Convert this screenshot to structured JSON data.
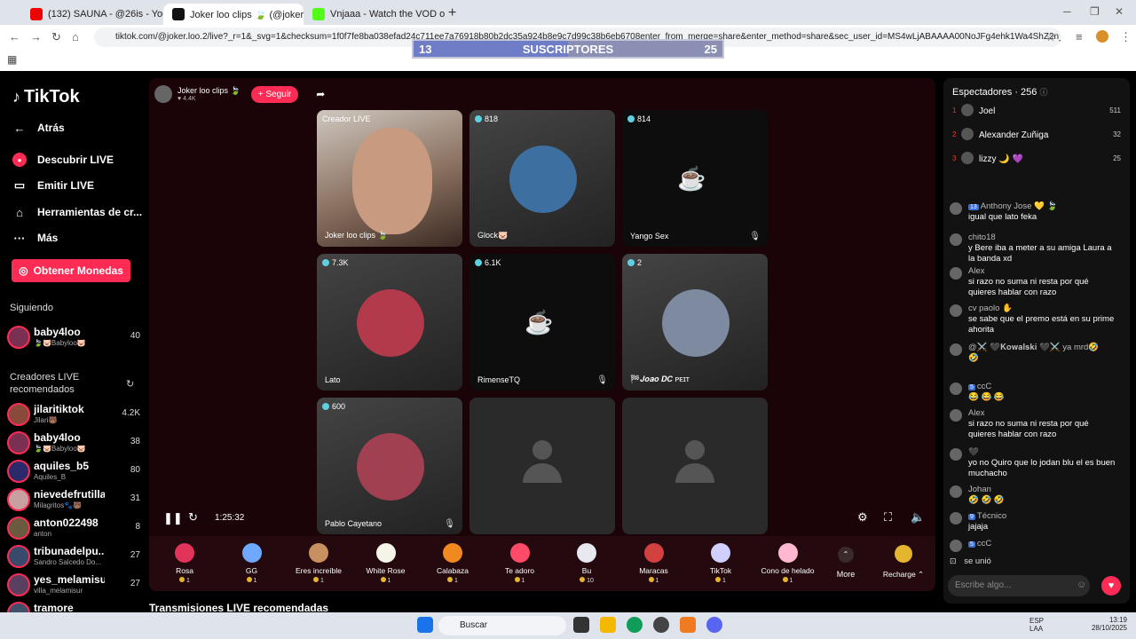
{
  "browser": {
    "tabs": [
      {
        "title": "(132) SAUNA - @26is - YouTube",
        "fav": "#e00"
      },
      {
        "title": "Joker loo clips 🍃 (@joker.l",
        "fav": "#111"
      },
      {
        "title": "Vnjaaa - Watch the VOD on Kick",
        "fav": "#53fc18"
      }
    ],
    "url": "tiktok.com/@joker.loo.2/live?_r=1&_svg=1&checksum=1f0f7fe8ba038efad24c711ee7a76918b80b2dc35a924b8e9c7d99c38b6eb6708enter_from_merge=share&enter_method=share&sec_user_id=MS4wLjABAAAA00NoJFg4ehk1Wa4ShZ2n_Acuqv_tVxR..."
  },
  "overlay": {
    "left": "13",
    "label": "SUSCRIPTORES",
    "right": "25",
    "progress": 0.5
  },
  "sidebar": {
    "logo": "TikTok",
    "nav": [
      {
        "label": "Atrás",
        "icon": "arrow-left-icon"
      },
      {
        "label": "Descubrir LIVE",
        "icon": "live-icon"
      },
      {
        "label": "Emitir LIVE",
        "icon": "camera-icon"
      },
      {
        "label": "Herramientas de cr...",
        "icon": "home-icon"
      },
      {
        "label": "Más",
        "icon": "more-icon"
      }
    ],
    "coins": "Obtener Monedas",
    "following_title": "Siguiendo",
    "following": [
      {
        "name": "baby4loo",
        "sub": "🍃🐷Babyloo🐷",
        "count": "40"
      }
    ],
    "rec_title": "Creadores LIVE recomendados",
    "recommended": [
      {
        "name": "jilaritiktok",
        "sub": "Jilari🐻",
        "count": "4.2K"
      },
      {
        "name": "baby4loo",
        "sub": "🍃🐷Babyloo🐷",
        "count": "38"
      },
      {
        "name": "aquiles_b5",
        "sub": "Aquiles_B",
        "count": "80"
      },
      {
        "name": "nievedefrutilla",
        "sub": "Milagritos🐾🐻",
        "count": "31"
      },
      {
        "name": "anton022498",
        "sub": "anton",
        "count": "8"
      },
      {
        "name": "tribunadelpu...",
        "sub": "Sandro Salcedo Do...",
        "count": "27"
      },
      {
        "name": "yes_melamisur",
        "sub": "villa_melamisur",
        "count": "27"
      },
      {
        "name": "tramore",
        "sub": "",
        "count": ""
      }
    ]
  },
  "stream": {
    "host": "Joker loo clips 🍃",
    "likes": "♥ 4.4K",
    "follow": "+ Seguir",
    "time": "1:25:32",
    "recs": "Transmisiones LIVE recomendadas",
    "tiles": [
      {
        "badge": "Creador LIVE",
        "name": "Joker loo clips 🍃",
        "mode": "video"
      },
      {
        "badge": "818",
        "name": "Glock🐷",
        "mode": "avatar",
        "color": "#3d6fa0"
      },
      {
        "badge": "814",
        "name": "Yango Sex",
        "mode": "cam-off"
      },
      {
        "badge": "7.3K",
        "name": "Lato",
        "mode": "avatar",
        "color": "#b23a4a"
      },
      {
        "badge": "6.1K",
        "name": "RimenseTQ",
        "mode": "cam-off"
      },
      {
        "badge": "2",
        "name": "🏁𝑱𝒐𝒂𝒐 𝑫𝑪 ᴘᴇɪᴛ",
        "mode": "avatar",
        "color": "#7d8aa0"
      },
      {
        "badge": "600",
        "name": "Pablo Cayetano",
        "mode": "avatar",
        "color": "#a04050"
      },
      {
        "badge": "",
        "name": "",
        "mode": "empty"
      },
      {
        "badge": "",
        "name": "",
        "mode": "empty"
      }
    ],
    "gifts": [
      {
        "label": "Rosa",
        "price": "1",
        "color": "#e2345a"
      },
      {
        "label": "GG",
        "price": "1",
        "color": "#6fa8ff"
      },
      {
        "label": "Eres increíble",
        "price": "1",
        "color": "#c89060"
      },
      {
        "label": "White Rose",
        "price": "1",
        "color": "#f4f4e8"
      },
      {
        "label": "Calabaza",
        "price": "1",
        "color": "#f08a20"
      },
      {
        "label": "Te adoro",
        "price": "1",
        "color": "#ff4a6a"
      },
      {
        "label": "Bu",
        "price": "10",
        "color": "#e8e8f0"
      },
      {
        "label": "Maracas",
        "price": "1",
        "color": "#d24040"
      },
      {
        "label": "TikTok",
        "price": "1",
        "color": "#d0d0ff"
      },
      {
        "label": "Cono de helado",
        "price": "1",
        "color": "#ffb8d0"
      }
    ],
    "more": "More",
    "recharge": "Recharge ⌃"
  },
  "chat": {
    "viewers_title": "Espectadores · 256",
    "top": [
      {
        "rank": "1",
        "name": "Joel",
        "score": "511"
      },
      {
        "rank": "2",
        "name": "Alexander Zuñiga",
        "score": "32"
      },
      {
        "rank": "3",
        "name": "lizzy 🌙 💜",
        "score": "25"
      }
    ],
    "messages": [
      {
        "lvl": "13",
        "user": "Anthony Jose 💛 🍃",
        "text": "igual que lato feka"
      },
      {
        "lvl": "",
        "user": "chito18",
        "text": "y Bere iba a meter a su amiga Laura a la banda xd"
      },
      {
        "lvl": "",
        "user": "Alex",
        "text": "si razo no suma ni resta por qué quieres hablar con razo"
      },
      {
        "lvl": "",
        "user": "cv paolo ✋",
        "text": "se sabe que el premo está en su prime ahorita"
      },
      {
        "lvl": "",
        "user": "@⚔️ 🖤𝐊𝐨𝐰𝐚𝐥𝐬𝐤𝐢 🖤⚔️ ya mrd🤣",
        "text": "🤣"
      },
      {
        "lvl": "5",
        "user": "ccC",
        "text": "😂 😂 😂"
      },
      {
        "lvl": "",
        "user": "Alex",
        "text": "si razo no suma ni resta por qué quieres hablar con razo"
      },
      {
        "lvl": "",
        "user": "🖤",
        "text": "yo no Quiro que lo jodan blu el es buen muchacho"
      },
      {
        "lvl": "",
        "user": "Johan",
        "text": "🤣 🤣 🤣"
      },
      {
        "lvl": "9",
        "user": "Técnico",
        "text": "jajaja"
      },
      {
        "lvl": "5",
        "user": "ccC",
        "text": ""
      }
    ],
    "joined": "se unió",
    "placeholder": "Escribe algo..."
  },
  "taskbar": {
    "search": "Buscar",
    "lang": "ESP\nLAA",
    "time": "13:19",
    "date": "28/10/2025"
  }
}
